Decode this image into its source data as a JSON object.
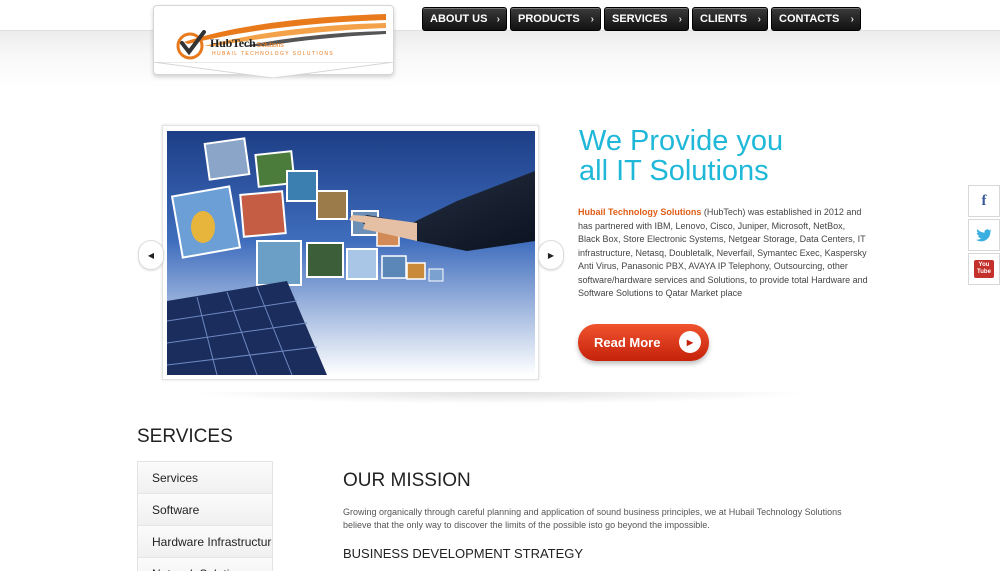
{
  "logo": {
    "name": "HubTech",
    "suffix": "Solutions",
    "tagline": "HUBAIL TECHNOLOGY SOLUTIONS",
    "accent": "#e87a1c"
  },
  "nav": {
    "items": [
      {
        "label": "ABOUT US"
      },
      {
        "label": "PRODUCTS"
      },
      {
        "label": "SERVICES"
      },
      {
        "label": "CLIENTS"
      },
      {
        "label": "CONTACTS"
      }
    ]
  },
  "hero": {
    "title_line1": "We Provide you",
    "title_line2": "all IT Solutions",
    "brand": "Hubail Technology Solutions",
    "body": " (HubTech) was established in 2012 and has partnered with IBM, Lenovo, Cisco, Juniper, Microsoft, NetBox, Black Box, Store Electronic Systems, Netgear Storage, Data Centers, IT infrastructure, Netasq, Doubletalk, Neverfail, Symantec Exec, Kaspersky Anti Virus, Panasonic PBX, AVAYA IP Telephony, Outsourcing, other software/hardware services and Solutions, to provide total Hardware and Software Solutions to Qatar Market place",
    "read_more": "Read More",
    "title_color": "#1fb8d8",
    "button_color": "#e0381a"
  },
  "social": {
    "facebook": "f",
    "youtube_top": "You",
    "youtube_bottom": "Tube"
  },
  "services": {
    "heading": "SERVICES",
    "menu": [
      {
        "label": "Services"
      },
      {
        "label": "Software"
      },
      {
        "label": "Hardware Infrastructure"
      },
      {
        "label": "Network Solutions"
      }
    ]
  },
  "mission": {
    "title": "OUR MISSION",
    "text": "Growing organically through careful planning and application of sound business principles, we at Hubail Technology Solutions believe that the only way to discover the limits of the possible isto go beyond the impossible.",
    "strategy_title": "BUSINESS DEVELOPMENT STRATEGY"
  }
}
